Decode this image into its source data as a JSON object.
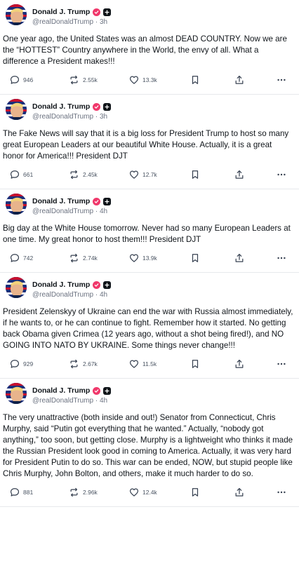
{
  "posts": [
    {
      "author": "Donald J. Trump",
      "handle": "@realDonaldTrump",
      "time": "3h",
      "text": "One year ago, the United States was an almost DEAD COUNTRY. Now we are the “HOTTEST” Country anywhere in the World, the envy of all. What a difference a President makes!!!",
      "replies": "946",
      "reposts": "2.55k",
      "likes": "13.3k"
    },
    {
      "author": "Donald J. Trump",
      "handle": "@realDonaldTrump",
      "time": "3h",
      "text": "The Fake News will say that it is a big loss for President Trump to host so many great European Leaders at our beautiful White House. Actually, it is a great honor for America!!! President DJT",
      "replies": "661",
      "reposts": "2.45k",
      "likes": "12.7k"
    },
    {
      "author": "Donald J. Trump",
      "handle": "@realDonaldTrump",
      "time": "4h",
      "text": "Big day at the White House tomorrow. Never had so many European Leaders at one time. My great honor to host them!!! President DJT",
      "replies": "742",
      "reposts": "2.74k",
      "likes": "13.9k"
    },
    {
      "author": "Donald J. Trump",
      "handle": "@realDonaldTrump",
      "time": "4h",
      "text": "President Zelenskyy of Ukraine can end the war with Russia almost immediately, if he wants to, or he can continue to fight. Remember how it started. No getting back Obama given Crimea (12 years ago, without a shot being fired!), and NO GOING INTO NATO BY UKRAINE. Some things never change!!!",
      "replies": "929",
      "reposts": "2.67k",
      "likes": "11.5k"
    },
    {
      "author": "Donald J. Trump",
      "handle": "@realDonaldTrump",
      "time": "4h",
      "text": "The very unattractive (both inside and out!) Senator from Connecticut, Chris Murphy, said “Putin got everything that he wanted.” Actually, “nobody got anything,” too soon, but getting close. Murphy is a lightweight who thinks it made the Russian President look good in coming to America. Actually, it was very hard for President Putin to do so. This war can be ended, NOW, but stupid people like Chris Murphy, John Bolton, and others, make it much harder to do so.",
      "replies": "881",
      "reposts": "2.96k",
      "likes": "12.4k"
    }
  ],
  "icons": {
    "reply": "speech-bubble-icon",
    "repost": "repost-arrows-icon",
    "like": "heart-icon",
    "save": "bookmark-icon",
    "share": "share-upload-icon",
    "more": "more-dots-icon",
    "verified": "verified-badge-icon",
    "plus": "plus-badge-icon"
  },
  "colors": {
    "verified_badge": "#f0386b",
    "text": "#0f1419",
    "muted": "#6b7280",
    "divider": "#e7e9ec"
  }
}
